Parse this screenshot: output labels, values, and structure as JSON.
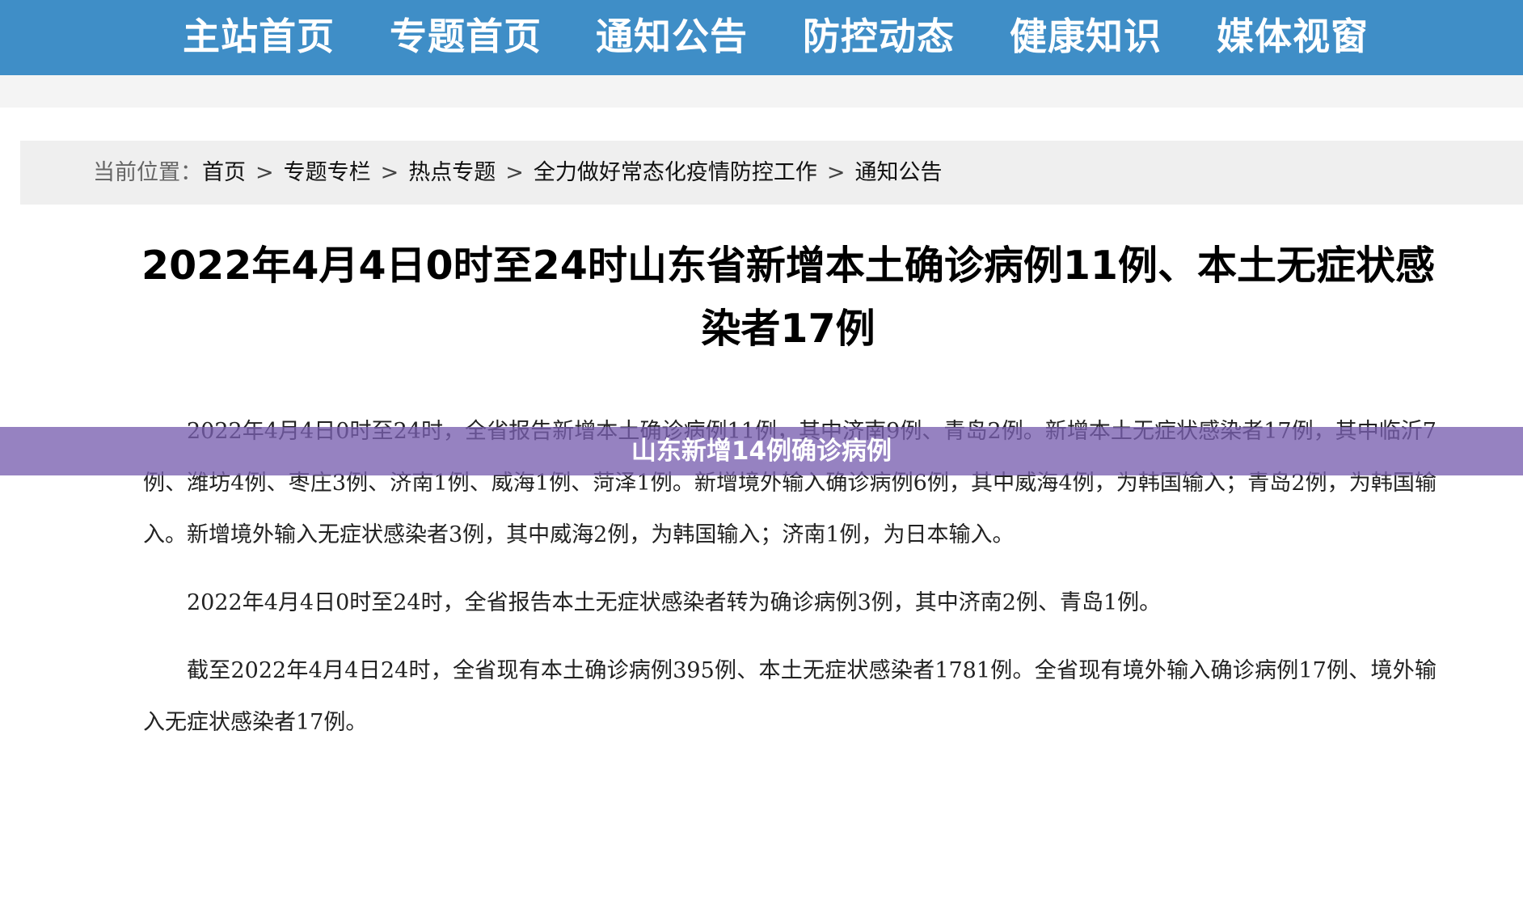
{
  "nav": {
    "items": [
      {
        "label": "主站首页"
      },
      {
        "label": "专题首页"
      },
      {
        "label": "通知公告"
      },
      {
        "label": "防控动态"
      },
      {
        "label": "健康知识"
      },
      {
        "label": "媒体视窗"
      }
    ]
  },
  "breadcrumb": {
    "label": "当前位置：",
    "separator": ">",
    "items": [
      {
        "label": "首页"
      },
      {
        "label": "专题专栏"
      },
      {
        "label": "热点专题"
      },
      {
        "label": "全力做好常态化疫情防控工作"
      },
      {
        "label": "通知公告"
      }
    ]
  },
  "article": {
    "title_line1": "2022年4月4日0时至24时山东省新增本土确诊病例11例、本土无症状感",
    "title_line2": "染者17例",
    "paragraphs": [
      "2022年4月4日0时至24时，全省报告新增本土确诊病例11例，其中济南9例、青岛2例。新增本土无症状感染者17例，其中临沂7例、潍坊4例、枣庄3例、济南1例、威海1例、菏泽1例。新增境外输入确诊病例6例，其中威海4例，为韩国输入；青岛2例，为韩国输入。新增境外输入无症状感染者3例，其中威海2例，为韩国输入；济南1例，为日本输入。",
      "2022年4月4日0时至24时，全省报告本土无症状感染者转为确诊病例3例，其中济南2例、青岛1例。",
      "截至2022年4月4日24时，全省现有本土确诊病例395例、本土无症状感染者1781例。全省现有境外输入确诊病例17例、境外输入无症状感染者17例。"
    ]
  },
  "overlay": {
    "text": "山东新增14例确诊病例"
  }
}
